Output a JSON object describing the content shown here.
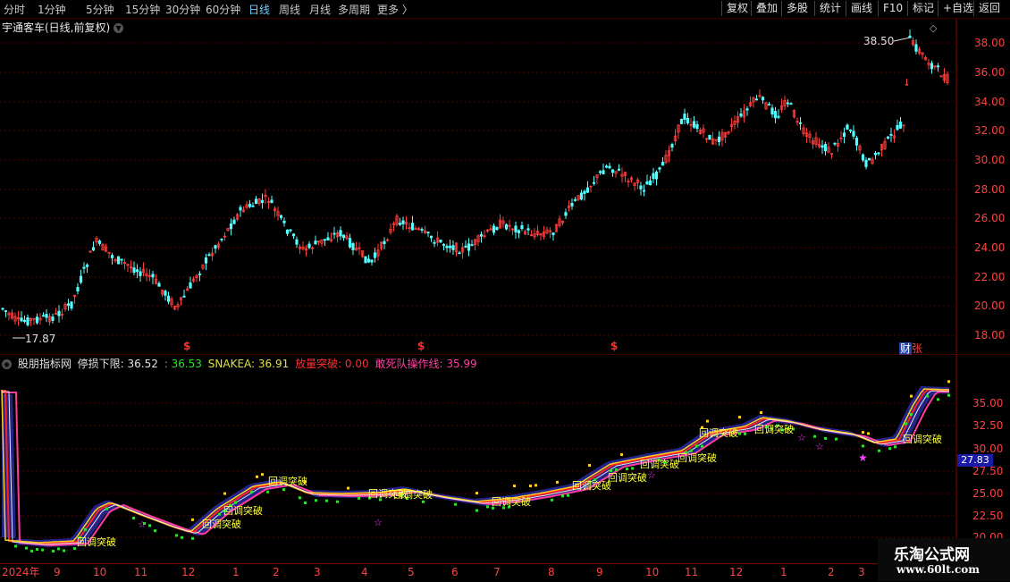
{
  "topbar": {
    "periods": [
      "分时",
      "1分钟",
      "5分钟",
      "15分钟",
      "30分钟",
      "60分钟",
      "日线",
      "周线",
      "月线",
      "多周期",
      "更多 〉"
    ],
    "active_period": "日线",
    "buttons": [
      "复权",
      "叠加",
      "多股",
      "统计",
      "画线",
      "F10",
      "标记",
      "+自选",
      "返回"
    ]
  },
  "main_chart": {
    "title": "宇通客车(日线,前复权)",
    "high_label": "38.50",
    "low_label": "17.87",
    "yticks": [
      "38.00",
      "36.00",
      "34.00",
      "32.00",
      "30.00",
      "28.00",
      "26.00",
      "24.00",
      "22.00",
      "20.00",
      "18.00"
    ],
    "event_marks": [
      "$",
      "$",
      "$"
    ],
    "corner_tag_a": "财",
    "corner_tag_b": "张"
  },
  "indicator": {
    "name": "股朋指标网",
    "stop_label": "停损下限: 36.52",
    "val2": ": 36.53",
    "snake": "SNAKEA: 36.91",
    "breakout": "放量突破: 0.00",
    "dare": "敢死队操作线: 35.99",
    "yticks": [
      "35.00",
      "32.50",
      "30.00",
      "27.50",
      "25.00",
      "22.50",
      "20.00"
    ],
    "current_price_box": "27.83",
    "signal_text": "回调突破",
    "colors": {
      "stop": "#e0e0e0",
      "val2": "#2fe02f",
      "snake": "#e0e040",
      "breakout": "#ff3030",
      "dare": "#ff40a0"
    }
  },
  "bottombar": {
    "year": "2024年",
    "months": [
      "9",
      "10",
      "11",
      "12",
      "1",
      "2",
      "3",
      "4",
      "5",
      "6",
      "7",
      "8",
      "9",
      "10",
      "11",
      "12",
      "1",
      "2",
      "3"
    ]
  },
  "watermark": {
    "line1": "乐淘公式网",
    "line2": "www.60lt.com"
  }
}
